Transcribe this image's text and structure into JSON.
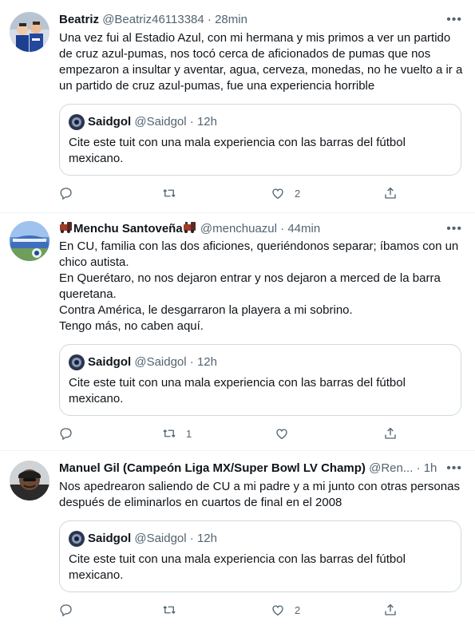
{
  "tweets": [
    {
      "name": "Beatriz",
      "handle": "@Beatriz46113384",
      "dot": "·",
      "time": "28min",
      "text": "Una vez fui al Estadio Azul, con mi hermana y mis primos a ver un partido\nde cruz azul-pumas, nos tocó cerca de aficionados de pumas que nos\nempezaron a insultar y aventar, agua, cerveza, monedas, no he vuelto a ir a\nun partido de cruz azul-pumas, fue una experiencia horrible",
      "quote": {
        "name": "Saidgol",
        "handle": "@Saidgol",
        "dot": "·",
        "time": "12h",
        "text": "Cite este tuit con una mala experiencia con las barras del fútbol\nmexicano."
      },
      "retweets": "",
      "likes": "2"
    },
    {
      "name": "Menchu Santoveña",
      "handle": "@menchuazul",
      "dot": "·",
      "time": "44min",
      "text": "En CU, familia con las dos aficiones, queriéndonos separar; íbamos con un\nchico autista.\nEn Querétaro, no nos dejaron entrar y nos dejaron a merced de la barra\nqueretana.\nContra América, le desgarraron la playera a mi sobrino.\nTengo más, no caben aquí.",
      "quote": {
        "name": "Saidgol",
        "handle": "@Saidgol",
        "dot": "·",
        "time": "12h",
        "text": "Cite este tuit con una mala experiencia con las barras del fútbol\nmexicano."
      },
      "retweets": "1",
      "likes": ""
    },
    {
      "name": "Manuel Gil (Campeón Liga MX/Super Bowl LV Champ)",
      "handle": "@Ren...",
      "dot": "·",
      "time": "1h",
      "text": "Nos apedrearon saliendo de CU a mi padre y a mi junto con otras personas\ndespués de eliminarlos en cuartos de final en el 2008",
      "quote": {
        "name": "Saidgol",
        "handle": "@Saidgol",
        "dot": "·",
        "time": "12h",
        "text": "Cite este tuit con una mala experiencia con las barras del fútbol\nmexicano."
      },
      "retweets": "",
      "likes": "2"
    }
  ],
  "ui": {
    "more": "•••"
  },
  "colors": {
    "text": "#0f1419",
    "muted": "#536471",
    "border": "#cfd9de",
    "divider": "#eff3f4"
  },
  "icons": [
    "reply-icon",
    "retweet-icon",
    "like-icon",
    "share-icon",
    "more-icon",
    "train-emoji-icon"
  ]
}
